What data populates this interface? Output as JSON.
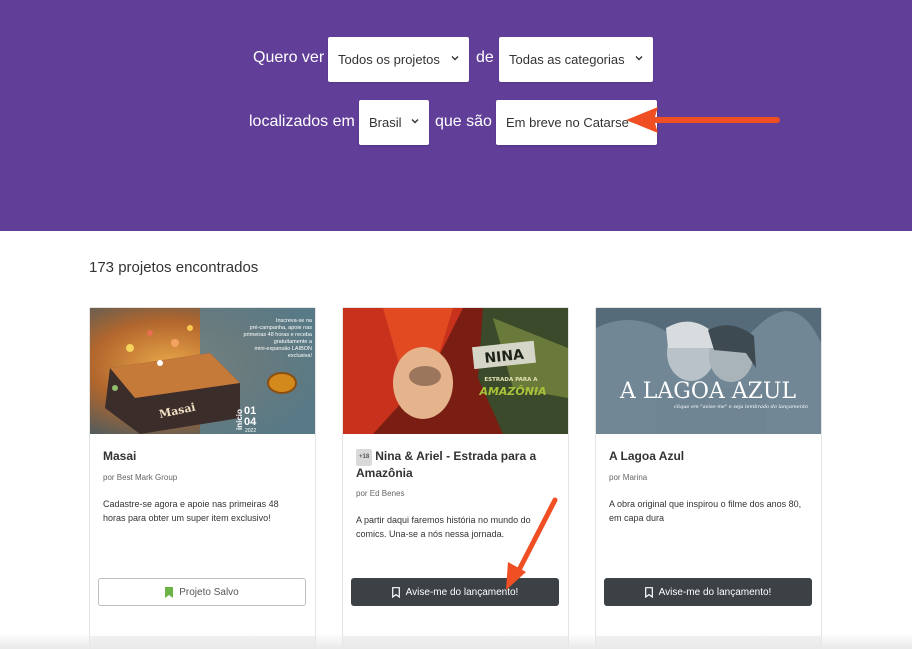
{
  "filters": {
    "want_to_see_label": "Quero ver",
    "of_label": "de",
    "located_in_label": "localizados em",
    "that_are_label": "que são",
    "projects_select": "Todos os projetos",
    "categories_select": "Todas as categorias",
    "location_select": "Brasil",
    "status_select": "Em breve no Catarse"
  },
  "results": {
    "count_text": "173 projetos encontrados"
  },
  "cards": [
    {
      "title": "Masai",
      "author": "por Best Mark Group",
      "description": "Cadastre-se agora e apoie nas primeiras 48 horas para obter um super item exclusivo!",
      "button_label": "Projeto Salvo",
      "button_icon": "bookmark-filled-icon",
      "image_text": {
        "box_title": "Masai",
        "promo_lines": [
          "Inscreva-se na",
          "pré-campanha, apoie nas",
          "primeiras 48 horas e receba",
          "gratuitamente a",
          "mini-expansão LAIBON",
          "exclusiva!"
        ],
        "date_day": "01",
        "date_month": "04",
        "date_year": "2022",
        "date_word": "início"
      }
    },
    {
      "title": "Nina & Ariel - Estrada para a Amazônia",
      "age_tag": "+18",
      "author": "por Ed Benes",
      "description": "A partir daqui faremos história no mundo do comics. Una-se a nós nessa jornada.",
      "button_label": "Avise-me do lançamento!",
      "button_icon": "bookmark-outline-icon",
      "image_text": {
        "logo_top": "NINA",
        "logo_sub": "ESTRADA PARA A",
        "logo_bottom": "AMAZÔNIA"
      }
    },
    {
      "title": "A Lagoa Azul",
      "author": "por Marina",
      "description": "A obra original que inspirou o filme dos anos 80, em capa dura",
      "button_label": "Avise-me do lançamento!",
      "button_icon": "bookmark-outline-icon",
      "image_text": {
        "headline": "A LAGOA AZUL",
        "tagline": "clique em \"avise-me\" e seja lembrado do lançamento"
      }
    }
  ],
  "colors": {
    "header_purple": "#613e98",
    "button_dark": "#3c4146",
    "saved_green": "#6ab344",
    "annotation_arrow": "#f04e23"
  }
}
